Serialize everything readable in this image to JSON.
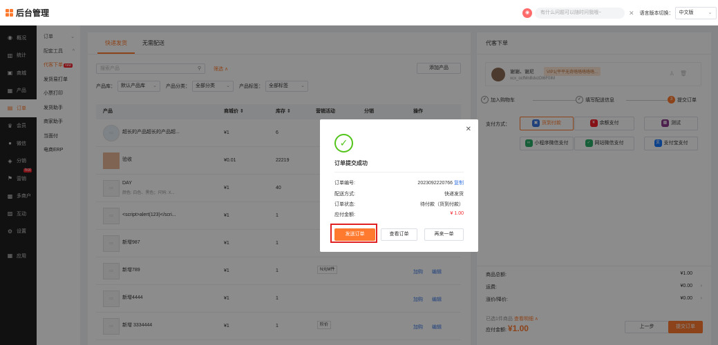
{
  "app": {
    "title": "后台管理"
  },
  "header": {
    "search_placeholder": "有什么问题可以随时问我哦~",
    "lang_label": "语言版本切换：",
    "lang_value": "中文版"
  },
  "nav1": [
    {
      "icon": "compass-icon",
      "glyph": "◉",
      "label": "概况"
    },
    {
      "icon": "chart-icon",
      "glyph": "▥",
      "label": "统计"
    },
    {
      "icon": "shop-icon",
      "glyph": "▣",
      "label": "商城"
    },
    {
      "icon": "grid-icon",
      "glyph": "▦",
      "label": "产品"
    },
    {
      "icon": "order-icon",
      "glyph": "▤",
      "label": "订单"
    },
    {
      "icon": "crown-icon",
      "glyph": "♛",
      "label": "会员"
    },
    {
      "icon": "wechat-icon",
      "glyph": "●",
      "label": "微信"
    },
    {
      "icon": "share-icon",
      "glyph": "◈",
      "label": "分销"
    },
    {
      "icon": "flag-icon",
      "glyph": "⚑",
      "label": "营销",
      "badge": "hot"
    },
    {
      "icon": "merchant-icon",
      "glyph": "▩",
      "label": "多商户"
    },
    {
      "icon": "interact-icon",
      "glyph": "▨",
      "label": "互动"
    },
    {
      "icon": "settings-icon",
      "glyph": "⚙",
      "label": "设置"
    },
    {
      "icon": "apps-icon",
      "glyph": "▦",
      "label": "应用"
    }
  ],
  "nav2": {
    "order": "订单",
    "tools": "配套工具",
    "items": [
      "代客下单",
      "发货易打单",
      "小票打印",
      "发货助手",
      "商家助手",
      "当面付",
      "电商ERP"
    ],
    "new_badge": "new"
  },
  "tabs": [
    "快递发货",
    "无需配送"
  ],
  "filters": {
    "search_placeholder": "搜索产品",
    "toggle": "筛选 ∧",
    "add_product": "添加产品",
    "lib_label": "产品库：",
    "lib_value": "默认产品库",
    "cat_label": "产品分类：",
    "cat_value": "全部分类",
    "tag_label": "产品标签：",
    "tag_value": "全部标签"
  },
  "table": {
    "headers": [
      "产品",
      "商城价 ⇕",
      "库存 ⇕",
      "营销活动",
      "分销",
      "操作"
    ],
    "rows": [
      {
        "name": "超长的产品超长的产品超...",
        "attr": "",
        "price": "¥1",
        "stock": "6",
        "tag": "",
        "ops": []
      },
      {
        "name": "验收",
        "attr": "",
        "price": "¥0.01",
        "stock": "22219",
        "tag": "",
        "ops": []
      },
      {
        "name": "DAY",
        "attr": "颜色: 白色、黑色；尺码: X...",
        "price": "¥1",
        "stock": "40",
        "tag": "",
        "ops": []
      },
      {
        "name": "<script>alert(123)</scri...",
        "attr": "",
        "price": "¥1",
        "stock": "1",
        "tag": "",
        "ops": []
      },
      {
        "name": "新增987",
        "attr": "",
        "price": "¥1",
        "stock": "1",
        "tag": "",
        "ops": []
      },
      {
        "name": "新增789",
        "attr": "",
        "price": "¥1",
        "stock": "1",
        "tag": "N元M件",
        "ops": [
          "加购",
          "编辑"
        ]
      },
      {
        "name": "新增4444",
        "attr": "",
        "price": "¥1",
        "stock": "1",
        "tag": "",
        "ops": [
          "加购",
          "编辑"
        ]
      },
      {
        "name": "新增 3334444",
        "attr": "",
        "price": "¥1",
        "stock": "1",
        "tag": "阶价",
        "ops": [
          "加购",
          "编辑"
        ]
      }
    ]
  },
  "right": {
    "title": "代客下单",
    "user": {
      "name": "谢谢、谢尼",
      "vip": "VIP1(平平无奇咯咯咯咯咯...",
      "id": "xcx_ocfMnBdvzDt6F0IM"
    },
    "steps": [
      {
        "num": "✓",
        "label": "加入购物车"
      },
      {
        "num": "✓",
        "label": "填写配送信息"
      },
      {
        "num": "3",
        "label": "提交订单"
      }
    ],
    "pay_label": "支付方式：",
    "pay": [
      {
        "label": "货到付款",
        "icon": "truck-icon",
        "color": "#3a77e0",
        "glyph": "▣"
      },
      {
        "label": "余额支付",
        "icon": "wallet-icon",
        "color": "#f5222d",
        "glyph": "¥"
      },
      {
        "label": "测试",
        "icon": "test-icon",
        "color": "#8b3a8b",
        "glyph": "▩"
      },
      {
        "label": "小程序微信支付",
        "icon": "miniapp-icon",
        "color": "#2aae67",
        "glyph": "∞"
      },
      {
        "label": "网站微信支付",
        "icon": "wechat-pay-icon",
        "color": "#2aae67",
        "glyph": "✓"
      },
      {
        "label": "支付宝支付",
        "icon": "alipay-icon",
        "color": "#1677ff",
        "glyph": "支"
      }
    ],
    "summary": {
      "goods_label": "商品总额:",
      "goods": "¥1.00",
      "freight_label": "运费:",
      "freight": "¥0.00",
      "adjust_label": "涨价/降价:",
      "adjust": "¥0.00"
    },
    "selected": "已选1件商品",
    "detail_link": "查看明细 ∧",
    "pay_total_label": "应付金额:",
    "pay_total": "¥1.00",
    "prev": "上一步",
    "submit": "提交订单"
  },
  "modal": {
    "title": "订单提交成功",
    "order_no_label": "订单编号:",
    "order_no": "2023092220766",
    "copy": "复制",
    "delivery_label": "配送方式:",
    "delivery": "快递发货",
    "status_label": "订单状态:",
    "status": "待付款（货到付款）",
    "amount_label": "应付金额:",
    "amount": "¥ 1.00",
    "send": "发送订单",
    "view": "查看订单",
    "again": "再来一单"
  }
}
